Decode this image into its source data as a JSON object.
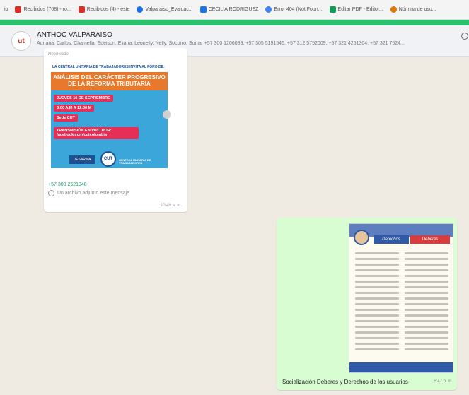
{
  "bookmarks": [
    {
      "label": "io",
      "color": "#888888"
    },
    {
      "label": "Recibidos (708) - ro...",
      "color": "#d93025"
    },
    {
      "label": "Recibidos (4) - este",
      "color": "#d93025"
    },
    {
      "label": "Valparaiso_Evaluac...",
      "color": "#1a73e8"
    },
    {
      "label": "CECILIA RODRIGUEZ",
      "color": "#1a73e8"
    },
    {
      "label": "Error 404 (Not Foun...",
      "color": "#4285f4"
    },
    {
      "label": "Editar PDF - Editor...",
      "color": "#0f9d58"
    },
    {
      "label": "Nómina de usu...",
      "color": "#e37400"
    }
  ],
  "chat": {
    "avatar_text": "ut",
    "title": "ANTHOC VALPARAISO",
    "members": "Adriana, Carlos, Chamella, Edeison, Eliana, Leonelly, Nelly, Socorro, Sonia, +57 300 1206089, +57 305 5191545, +57 312 5752009, +57 321 4251304, +57 321 7524..."
  },
  "incoming_message": {
    "forwarded_label": "Reenviado",
    "poster": {
      "top_text": "LA CENTRAL UNITARIA DE TRABAJADORES INVITA AL FORO DE:",
      "title": "ANÁLISIS DEL CARÁCTER PROGRESIVO DE LA REFORMA TRIBUTARIA",
      "date": "JUEVES 16 DE SEPTIEMBRE",
      "time": "8:00 A.M A 12:00 M",
      "place": "Sede CUT",
      "stream": "TRANSMISIÓN EN VIVO POR: facebook.com/cutcolombia",
      "logo": "DESARMA",
      "seal": "CUT",
      "cut_text": "CENTRAL UNITARIA DE TRABAJADORES"
    },
    "sender": "+57 300 2521048",
    "sender_pushname": "",
    "status": "Un archivo adjunto este mensaje",
    "time": "10:49 a. m."
  },
  "outgoing_message": {
    "flyer": {
      "tab_left": "Derechos",
      "tab_right": "Deberes"
    },
    "caption": "Socialización Deberes y Derechos de los usuarios",
    "time": "5:47 p. m."
  }
}
